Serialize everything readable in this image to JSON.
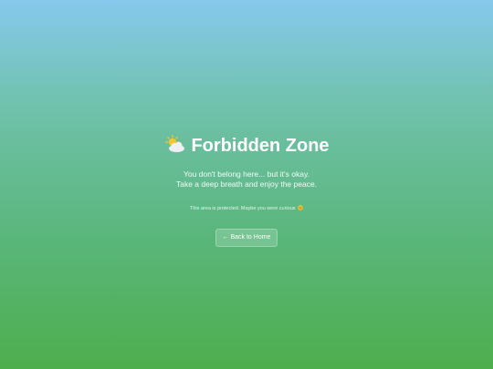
{
  "page": {
    "title_icon": "sun-behind-cloud-icon",
    "title": "Forbidden Zone",
    "message_line1": "You don't belong here... but it's okay.",
    "message_line2": "Take a deep breath and enjoy the peace.",
    "note": "This area is protected. Maybe you were curious",
    "note_icon": "smiling-face-icon",
    "back_button_label": "← Back to Home"
  },
  "colors": {
    "gradient_top": "#86c9ec",
    "gradient_bottom": "#4eae4d",
    "text": "#ffffff"
  }
}
